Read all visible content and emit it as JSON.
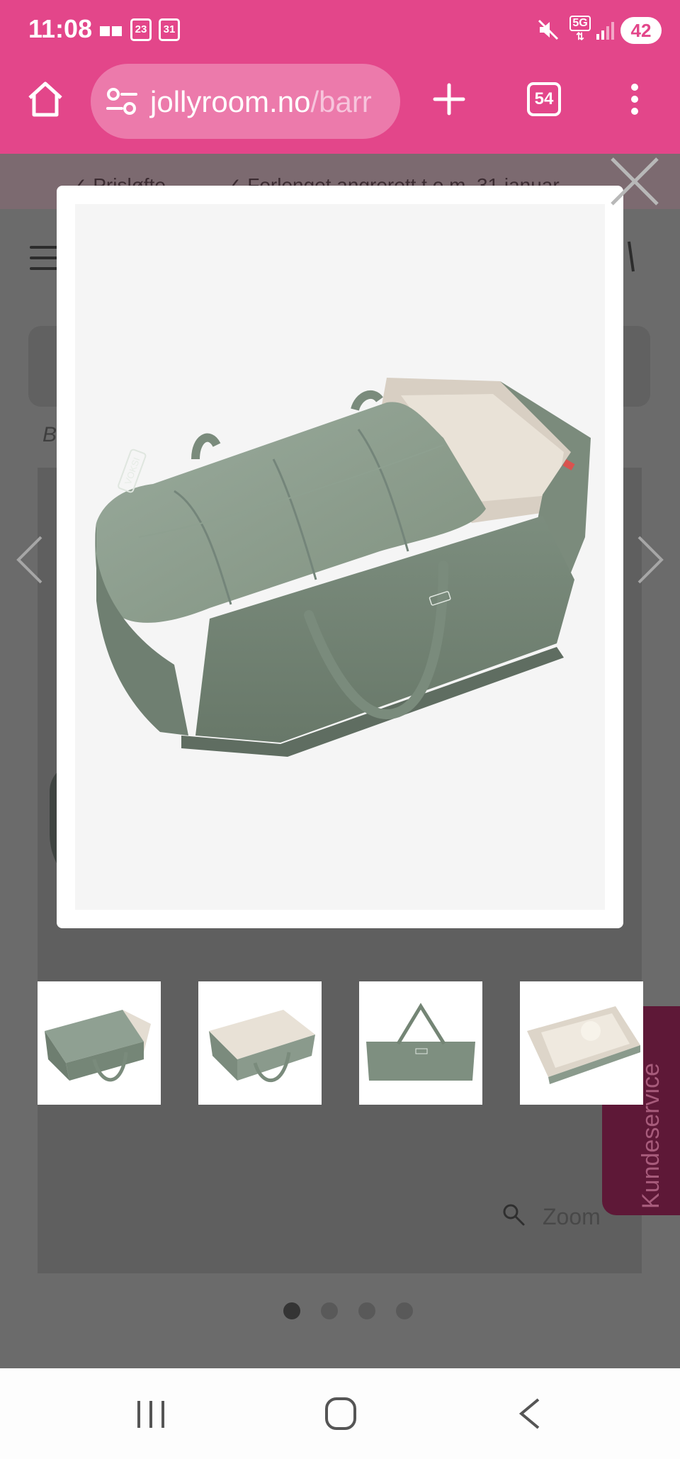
{
  "status_bar": {
    "time": "11:08",
    "calendar_day": "23",
    "calendar_date": "31",
    "network": "5G",
    "battery": "42"
  },
  "browser": {
    "url_host": "jollyroom.no",
    "url_path": "/barr",
    "tab_count": "54"
  },
  "page": {
    "usp_1": "✓ Prisløfte",
    "usp_2": "✓ Forlenget angrerett t.o.m. 31 januar",
    "breadcrumb": "B",
    "zoom_label": "Zoom",
    "customer_service": "Kundeservice"
  },
  "lightbox": {
    "brand_text": "VOKSI",
    "thumbnails": [
      "carry-cot-covered",
      "carry-cot-open",
      "carry-cot-side",
      "carry-cot-top"
    ],
    "dots": [
      true,
      false,
      false,
      false
    ]
  },
  "colors": {
    "accent": "#e3468a",
    "side_tab": "#5e1837",
    "product_green": "#8a9b8d"
  }
}
